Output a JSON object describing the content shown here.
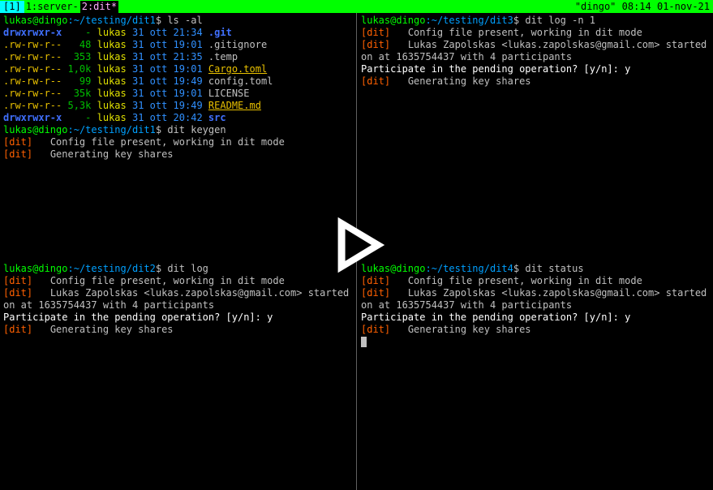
{
  "statusbar": {
    "session": "[1]",
    "windows": [
      {
        "label": "1:server-",
        "active": false
      },
      {
        "label": "2:dit*",
        "active": true
      }
    ],
    "right": "\"dingo\" 08:14 01-nov-21"
  },
  "panes": {
    "tl": {
      "prompt_user": "lukas@dingo",
      "prompt_path": "~/testing/dit1",
      "cmd1": "ls -al",
      "ls": [
        {
          "perm": "drwxrwxr-x",
          "size": "-",
          "owner": "lukas",
          "date": "31 ott 21:34",
          "name": ".git",
          "kind": "dir"
        },
        {
          "perm": ".rw-rw-r--",
          "size": "48",
          "owner": "lukas",
          "date": "31 ott 19:01",
          "name": ".gitignore",
          "kind": "file"
        },
        {
          "perm": ".rw-rw-r--",
          "size": "353",
          "owner": "lukas",
          "date": "31 ott 21:35",
          "name": ".temp",
          "kind": "file"
        },
        {
          "perm": ".rw-rw-r--",
          "size": "1,0k",
          "owner": "lukas",
          "date": "31 ott 19:01",
          "name": "Cargo.toml",
          "kind": "link"
        },
        {
          "perm": ".rw-rw-r--",
          "size": "99",
          "owner": "lukas",
          "date": "31 ott 19:49",
          "name": "config.toml",
          "kind": "file"
        },
        {
          "perm": ".rw-rw-r--",
          "size": "35k",
          "owner": "lukas",
          "date": "31 ott 19:01",
          "name": "LICENSE",
          "kind": "file"
        },
        {
          "perm": ".rw-rw-r--",
          "size": "5,3k",
          "owner": "lukas",
          "date": "31 ott 19:49",
          "name": "README.md",
          "kind": "link"
        },
        {
          "perm": "drwxrwxr-x",
          "size": "-",
          "owner": "lukas",
          "date": "31 ott 20:42",
          "name": "src",
          "kind": "dir"
        }
      ],
      "cmd2": "dit keygen",
      "out2_1_tag": "[dit]",
      "out2_1_txt": "Config file present, working in dit mode",
      "out2_2_tag": "[dit]",
      "out2_2_txt": "Generating key shares"
    },
    "tr": {
      "prompt_user": "lukas@dingo",
      "prompt_path": "~/testing/dit3",
      "cmd": "dit log -n 1",
      "l1_tag": "[dit]",
      "l1_txt": "Config file present, working in dit mode",
      "l2_tag": "[dit]",
      "l2_txt": "Lukas Zapolskas <lukas.zapolskas@gmail.com> started key generati",
      "l3": "on at 1635754437 with 4 participants",
      "l4": "Participate in the pending operation? [y/n]: y",
      "l5_tag": "[dit]",
      "l5_txt": "Generating key shares"
    },
    "bl": {
      "prompt_user": "lukas@dingo",
      "prompt_path": "~/testing/dit2",
      "cmd": "dit log",
      "l1_tag": "[dit]",
      "l1_txt": "Config file present, working in dit mode",
      "l2_tag": "[dit]",
      "l2_txt": "Lukas Zapolskas <lukas.zapolskas@gmail.com> started key generati",
      "l3": "on at 1635754437 with 4 participants",
      "l4": "Participate in the pending operation? [y/n]: y",
      "l5_tag": "[dit]",
      "l5_txt": "Generating key shares"
    },
    "br": {
      "prompt_user": "lukas@dingo",
      "prompt_path": "~/testing/dit4",
      "cmd": "dit status",
      "l1_tag": "[dit]",
      "l1_txt": "Config file present, working in dit mode",
      "l2_tag": "[dit]",
      "l2_txt": "Lukas Zapolskas <lukas.zapolskas@gmail.com> started key generati",
      "l3": "on at 1635754437 with 4 participants",
      "l4": "Participate in the pending operation? [y/n]: y",
      "l5_tag": "[dit]",
      "l5_txt": "Generating key shares"
    }
  }
}
